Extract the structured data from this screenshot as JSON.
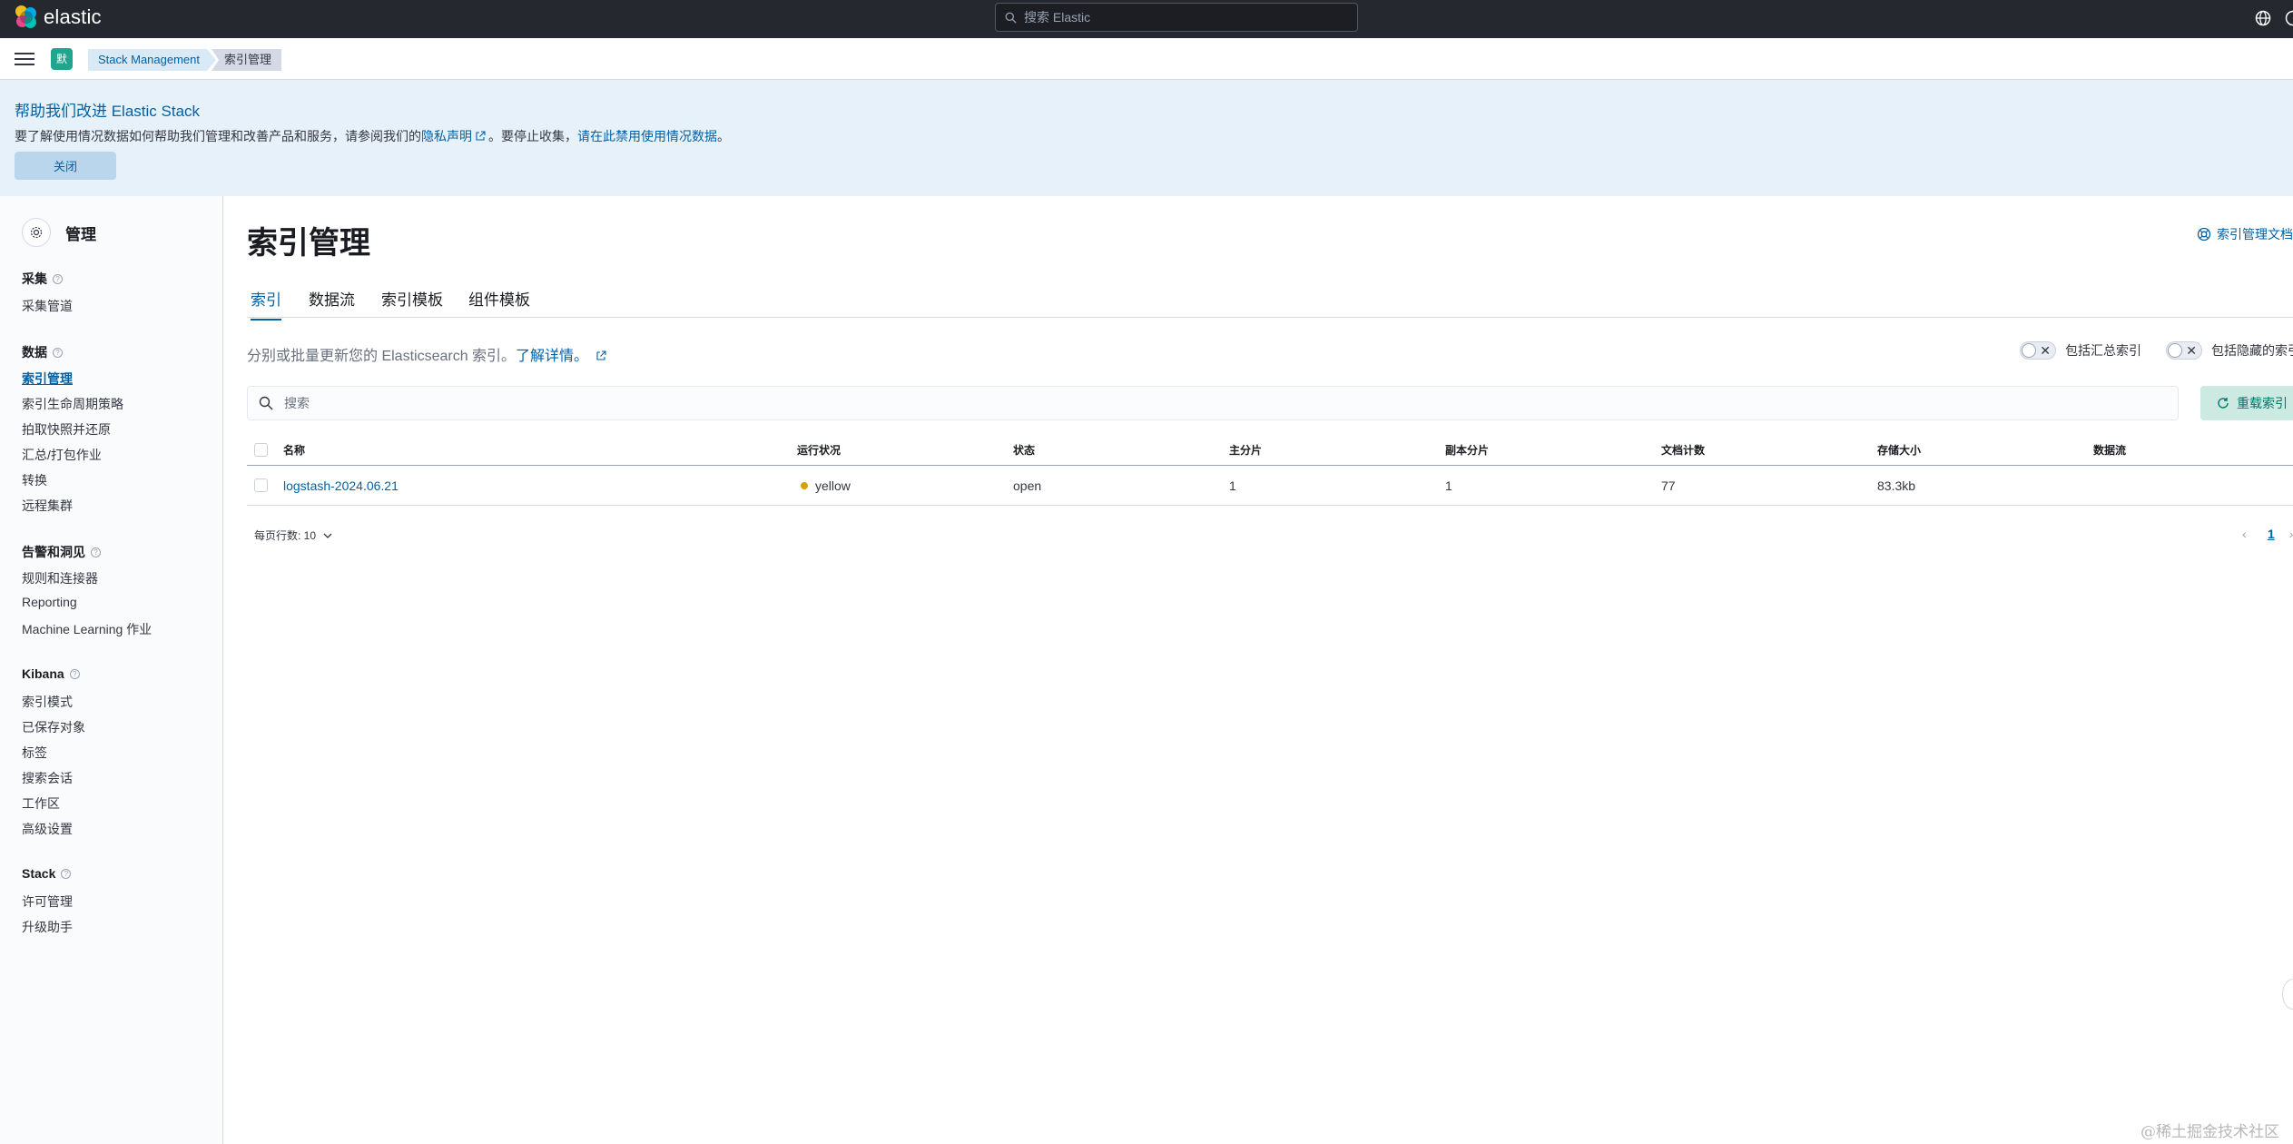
{
  "header": {
    "logo_text": "elastic",
    "search_placeholder": "搜索 Elastic",
    "icons": [
      "globe-icon",
      "help-icon"
    ]
  },
  "subbar": {
    "space_initial": "默",
    "breadcrumbs": [
      "Stack Management",
      "索引管理"
    ]
  },
  "banner": {
    "title": "帮助我们改进 Elastic Stack",
    "text_before": "要了解使用情况数据如何帮助我们管理和改善产品和服务，请参阅我们的",
    "privacy_link": "隐私声明",
    "text_middle": "。要停止收集，",
    "disable_link": "请在此禁用使用情况数据",
    "text_end": "。",
    "close_label": "关闭"
  },
  "sidebar": {
    "title": "管理",
    "groups": [
      {
        "label": "采集",
        "items": [
          "采集管道"
        ]
      },
      {
        "label": "数据",
        "items": [
          "索引管理",
          "索引生命周期策略",
          "拍取快照并还原",
          "汇总/打包作业",
          "转换",
          "远程集群"
        ]
      },
      {
        "label": "告警和洞见",
        "items": [
          "规则和连接器",
          "Reporting",
          "Machine Learning 作业"
        ]
      },
      {
        "label": "Kibana",
        "items": [
          "索引模式",
          "已保存对象",
          "标签",
          "搜索会话",
          "工作区",
          "高级设置"
        ]
      },
      {
        "label": "Stack",
        "items": [
          "许可管理",
          "升级助手"
        ]
      }
    ],
    "active_item": "索引管理"
  },
  "main": {
    "title": "索引管理",
    "doc_link": "索引管理文档",
    "tabs": [
      "索引",
      "数据流",
      "索引模板",
      "组件模板"
    ],
    "active_tab": "索引",
    "description": "分别或批量更新您的 Elasticsearch 索引。",
    "learn_more": "了解详情。",
    "toggle_rollup": "包括汇总索引",
    "toggle_hidden": "包括隐藏的索引",
    "search_placeholder": "搜索",
    "reload_label": "重载索引"
  },
  "table": {
    "columns": [
      "名称",
      "运行状况",
      "状态",
      "主分片",
      "副本分片",
      "文档计数",
      "存储大小",
      "数据流"
    ],
    "rows": [
      {
        "name": "logstash-2024.06.21",
        "health": "yellow",
        "status": "open",
        "primaries": "1",
        "replicas": "1",
        "docs_count": "77",
        "storage_size": "83.3kb",
        "data_stream": ""
      }
    ],
    "health_color": "#d6a200",
    "rows_per_page": "每页行数: 10",
    "current_page": "1"
  },
  "colors": {
    "accent": "#0061a6",
    "header_bg": "#25282f",
    "banner_bg": "#e6f1fa",
    "success": "#00776a"
  },
  "watermark": "@稀土掘金技术社区"
}
